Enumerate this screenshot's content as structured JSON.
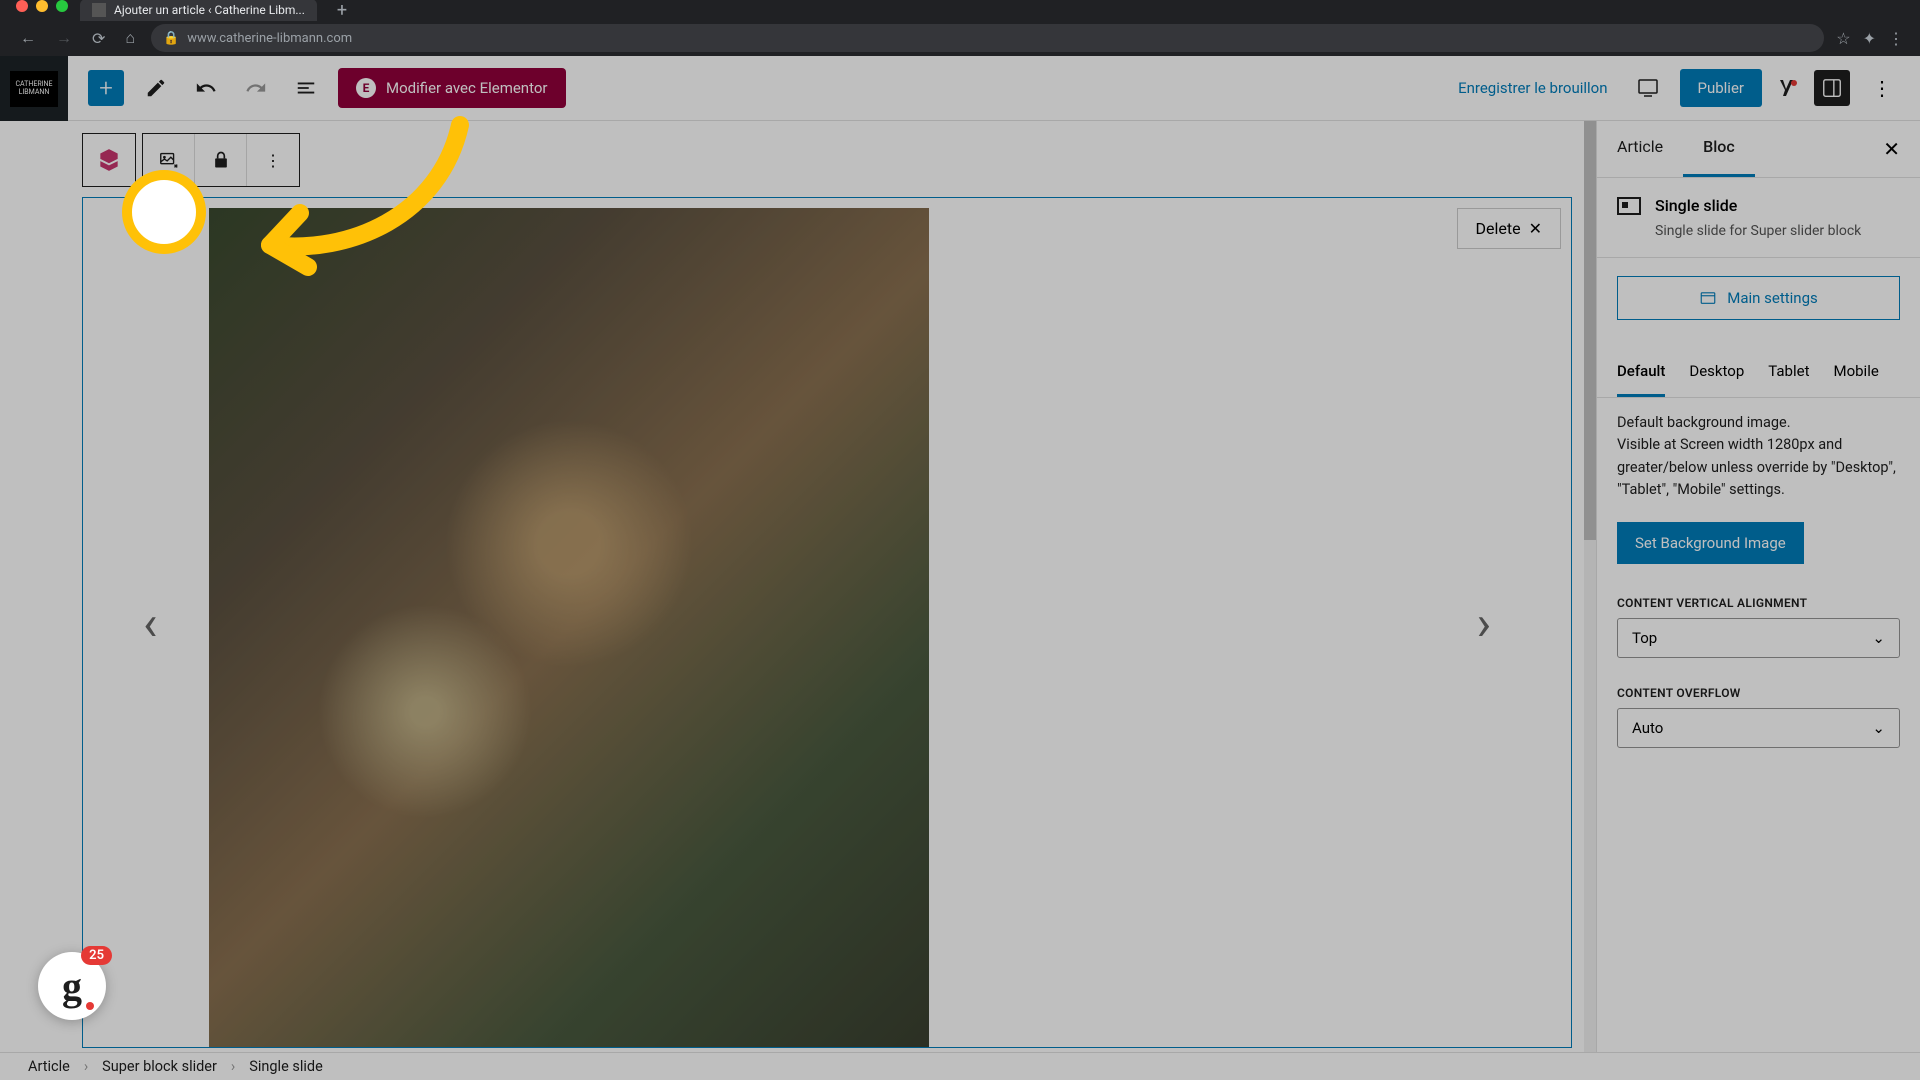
{
  "browser": {
    "tab_title": "Ajouter un article ‹ Catherine Libm...",
    "url": "www.catherine-libmann.com"
  },
  "site": {
    "logo_text": "CATHERINE LIBMANN"
  },
  "toolbar": {
    "elementor_label": "Modifier avec Elementor",
    "save_draft": "Enregistrer le brouillon",
    "publish": "Publier"
  },
  "block_toolbar": {
    "delete_label": "Delete"
  },
  "sidebar": {
    "tabs": {
      "article": "Article",
      "bloc": "Bloc"
    },
    "block_title": "Single slide",
    "block_desc": "Single slide for Super slider block",
    "main_settings": "Main settings",
    "responsive": {
      "tabs": [
        "Default",
        "Desktop",
        "Tablet",
        "Mobile"
      ],
      "desc": "Default background image.\nVisible at Screen width 1280px and greater/below unless override by \"Desktop\", \"Tablet\", \"Mobile\" settings."
    },
    "set_bg_btn": "Set Background Image",
    "valign_label": "CONTENT VERTICAL ALIGNMENT",
    "valign_value": "Top",
    "overflow_label": "CONTENT OVERFLOW",
    "overflow_value": "Auto"
  },
  "breadcrumb": [
    "Article",
    "Super block slider",
    "Single slide"
  ],
  "guidde": {
    "badge": "25"
  }
}
